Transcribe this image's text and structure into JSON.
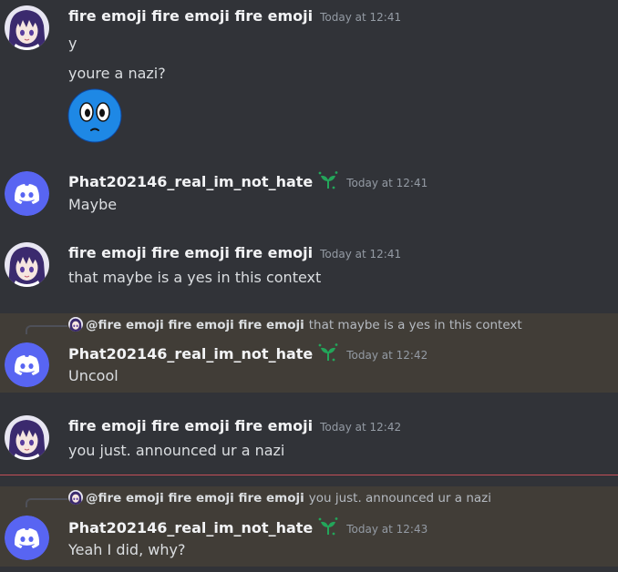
{
  "messages": [
    {
      "username": "fire emoji fire emoji fire emoji",
      "timestamp": "Today at 12:41",
      "lines": [
        "y",
        "youre a nazi?"
      ]
    },
    {
      "username": "Phat202146_real_im_not_hate",
      "timestamp": "Today at 12:41",
      "text": "Maybe"
    },
    {
      "username": "fire emoji fire emoji fire emoji",
      "timestamp": "Today at 12:41",
      "text": "that maybe is a yes in this context"
    },
    {
      "reply_to": "@fire emoji fire emoji fire emoji",
      "reply_text": "that maybe is a yes in this context",
      "username": "Phat202146_real_im_not_hate",
      "timestamp": "Today at 12:42",
      "text": "Uncool"
    },
    {
      "username": "fire emoji fire emoji fire emoji",
      "timestamp": "Today at 12:42",
      "text": "you just. announced ur a nazi"
    },
    {
      "reply_to": "@fire emoji fire emoji fire emoji",
      "reply_text": "you just. announced ur a nazi",
      "username": "Phat202146_real_im_not_hate",
      "timestamp": "Today at 12:43",
      "text": "Yeah I did, why?"
    }
  ],
  "colors": {
    "background": "#313338",
    "reply_highlight": "#413d37",
    "discord_blurple": "#5865f2",
    "anime_purple": "#3b2a6e",
    "badge_green": "#23a55a",
    "new_messages_divider": "#c34e57",
    "emoji_blue": "#1e88e5"
  },
  "icons": {
    "anime_avatar": "anime-girl-avatar-icon",
    "discord_avatar": "discord-logo-avatar-icon",
    "badge": "sprout-badge-icon",
    "emoji": "scared-face-emoji"
  }
}
